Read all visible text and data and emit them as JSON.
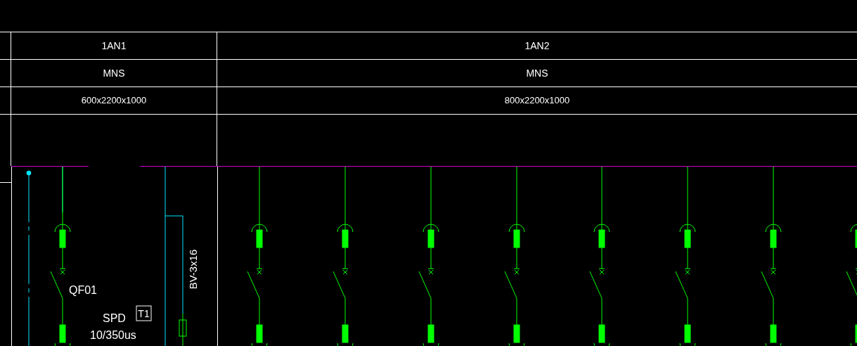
{
  "panels": [
    {
      "designation": "1AN1",
      "model": "MNS",
      "dimensions": "600x2200x1000"
    },
    {
      "designation": "1AN2",
      "model": "MNS",
      "dimensions": "800x2200x1000"
    }
  ],
  "incoming": {
    "breaker": "QF01",
    "spd_label": "SPD",
    "spd_class": "T1",
    "spd_rating": "10/350us",
    "cable": "BV-3x16"
  },
  "feeders": [
    {
      "kind": "breaker"
    },
    {
      "kind": "breaker"
    },
    {
      "kind": "breaker"
    },
    {
      "kind": "breaker"
    },
    {
      "kind": "breaker"
    },
    {
      "kind": "breaker"
    },
    {
      "kind": "breaker"
    },
    {
      "kind": "breaker"
    }
  ]
}
